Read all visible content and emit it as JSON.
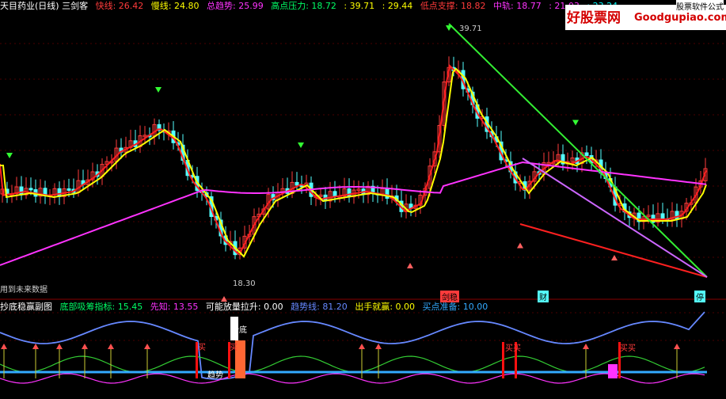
{
  "main_header": {
    "title": "天目药业(日线) 三剑客",
    "items": [
      {
        "label": "快线",
        "value": "26.42",
        "color": "#ff3b3b"
      },
      {
        "label": "慢线",
        "value": "24.80",
        "color": "#ffff00"
      },
      {
        "label": "总趋势",
        "value": "25.99",
        "color": "#ff33ff"
      },
      {
        "label": "高点压力",
        "value": "18.72",
        "color": "#00ff66"
      },
      {
        "label": "",
        "value": "39.71",
        "color": "#ffff00"
      },
      {
        "label": "",
        "value": "29.44",
        "color": "#ffff00"
      },
      {
        "label": "低点支撑",
        "value": "18.82",
        "color": "#ff3b3b"
      },
      {
        "label": "中轨",
        "value": "18.77",
        "color": "#ff33ff"
      },
      {
        "label": "",
        "value": "21.03",
        "color": "#ff33ff"
      },
      {
        "label": "",
        "value": "23.24",
        "color": "#00ffff"
      }
    ]
  },
  "watermark": {
    "cn": "好股票网",
    "en": "Goodgupiao.com",
    "tag": "股票软件公式"
  },
  "annotations": {
    "high": "39.71",
    "low": "18.30",
    "future": "用到未来数据"
  },
  "markers": [
    {
      "label": "剑稳",
      "color": "#ff3b3b"
    },
    {
      "label": "财",
      "color": "#00ffff"
    },
    {
      "label": "停",
      "color": "#00ffff"
    }
  ],
  "sub_header": {
    "title": "抄底稳赢副图",
    "items": [
      {
        "label": "底部吸筹指标",
        "value": "15.45",
        "color": "#00ff66"
      },
      {
        "label": "先知",
        "value": "13.55",
        "color": "#ff33ff"
      },
      {
        "label": "可能放量拉升",
        "value": "0.00",
        "color": "#ffffff"
      },
      {
        "label": "趋势线",
        "value": "81.20",
        "color": "#6688ff"
      },
      {
        "label": "出手就赢",
        "value": "0.00",
        "color": "#ffff00"
      },
      {
        "label": "买点准备",
        "value": "10.00",
        "color": "#33aaff"
      }
    ]
  },
  "sub_labels": {
    "bottom": "抄底",
    "buy": "买",
    "buy2": "买买",
    "trend": "趋势"
  },
  "colors": {
    "up": "#ff3b3b",
    "down": "#54ffff",
    "fast": "#ff2020",
    "slow": "#ffff00",
    "trend": "#ff33ff"
  }
}
